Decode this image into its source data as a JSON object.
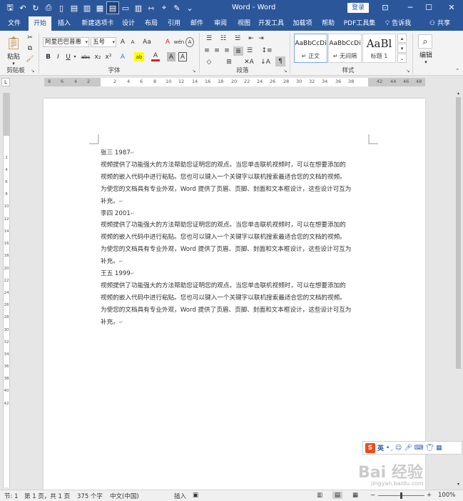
{
  "window": {
    "title": "Word - Word",
    "login_label": "登录",
    "restore_icon": "ribbon-display-icon",
    "minimize": "─",
    "maximize": "☐",
    "close": "✕"
  },
  "tabs": [
    {
      "label": "文件",
      "active": false
    },
    {
      "label": "开始",
      "active": true
    },
    {
      "label": "插入",
      "active": false
    },
    {
      "label": "新建选项卡",
      "active": false
    },
    {
      "label": "设计",
      "active": false
    },
    {
      "label": "布局",
      "active": false
    },
    {
      "label": "引用",
      "active": false
    },
    {
      "label": "邮件",
      "active": false
    },
    {
      "label": "审阅",
      "active": false
    },
    {
      "label": "视图",
      "active": false
    },
    {
      "label": "开发工具",
      "active": false
    },
    {
      "label": "加载项",
      "active": false
    },
    {
      "label": "帮助",
      "active": false
    },
    {
      "label": "PDF工具集",
      "active": false
    }
  ],
  "tell_me": "告诉我",
  "share": "共享",
  "ribbon": {
    "clipboard": {
      "paste_label": "粘贴",
      "group_label": "剪贴板"
    },
    "font": {
      "font_name": "阿里巴巴普惠",
      "font_size": "五号",
      "grow": "A",
      "shrink": "A",
      "case": "Aa",
      "clear": "A",
      "wen": "wén",
      "bold": "B",
      "italic": "I",
      "underline": "U",
      "strike": "abc",
      "subscript": "x₂",
      "superscript": "x²",
      "effects": "A",
      "highlight": "ab",
      "font_color": "A",
      "char_shade": "A",
      "enclose": "A",
      "group_label": "字体"
    },
    "paragraph": {
      "group_label": "段落"
    },
    "styles": {
      "group_label": "样式",
      "items": [
        {
          "sample": "AaBbCcDi",
          "name": "正文"
        },
        {
          "sample": "AaBbCcDi",
          "name": "无间隔"
        },
        {
          "sample": "AaBl",
          "name": "标题 1"
        }
      ]
    },
    "editing": {
      "label": "编辑"
    }
  },
  "ruler": {
    "corner": "L",
    "numbers": [
      "8",
      "6",
      "4",
      "2",
      "2",
      "4",
      "6",
      "8",
      "10",
      "12",
      "14",
      "16",
      "18",
      "20",
      "22",
      "24",
      "26",
      "28",
      "30",
      "32",
      "34",
      "36",
      "38",
      "42",
      "44",
      "46",
      "48"
    ],
    "vnumbers": [
      "2",
      "4",
      "6",
      "8",
      "10",
      "12",
      "14",
      "16",
      "18",
      "20",
      "22",
      "24",
      "26",
      "28",
      "30",
      "32",
      "34",
      "36",
      "38",
      "40",
      "42"
    ]
  },
  "document": {
    "paragraphs": [
      "张三 1987",
      "视频提供了功能强大的方法帮助您证明您的观点。当您单击联机视频时，可以在想要添加的",
      "视频的嵌入代码中进行粘贴。您也可以键入一个关键字以联机搜索最适合您的文档的视频。",
      "为使您的文档具有专业外观，Word 提供了页眉、页脚、封面和文本框设计，这些设计可互为",
      "补充。",
      "李四 2001",
      "视频提供了功能强大的方法帮助您证明您的观点。当您单击联机视频时，可以在想要添加的",
      "视频的嵌入代码中进行粘贴。您也可以键入一个关键字以联机搜索最适合您的文档的视频。",
      "为使您的文档具有专业外观，Word 提供了页眉、页脚、封面和文本框设计，这些设计可互为",
      "补充。",
      "王五 1999",
      "视频提供了功能强大的方法帮助您证明您的观点。当您单击联机视频时，可以在想要添加的",
      "视频的嵌入代码中进行粘贴。您也可以键入一个关键字以联机搜索最适合您的文档的视频。",
      "为使您的文档具有专业外观，Word 提供了页眉、页脚、封面和文本框设计，这些设计可互为",
      "补充。"
    ],
    "para_mark": "↵"
  },
  "ime": {
    "logo": "S",
    "mode": "英"
  },
  "watermark": {
    "main": "Bai 经验",
    "sub": "jingyan.baidu.com"
  },
  "status": {
    "section": "节: 1",
    "page": "第 1 页，共 1 页",
    "words": "375 个字",
    "language": "中文(中国)",
    "insert_mode": "插入",
    "zoom": "100%"
  },
  "colors": {
    "title_blue": "#2b579a",
    "ribbon_bg": "#f3f3f3",
    "ime_orange": "#e94e1b"
  }
}
